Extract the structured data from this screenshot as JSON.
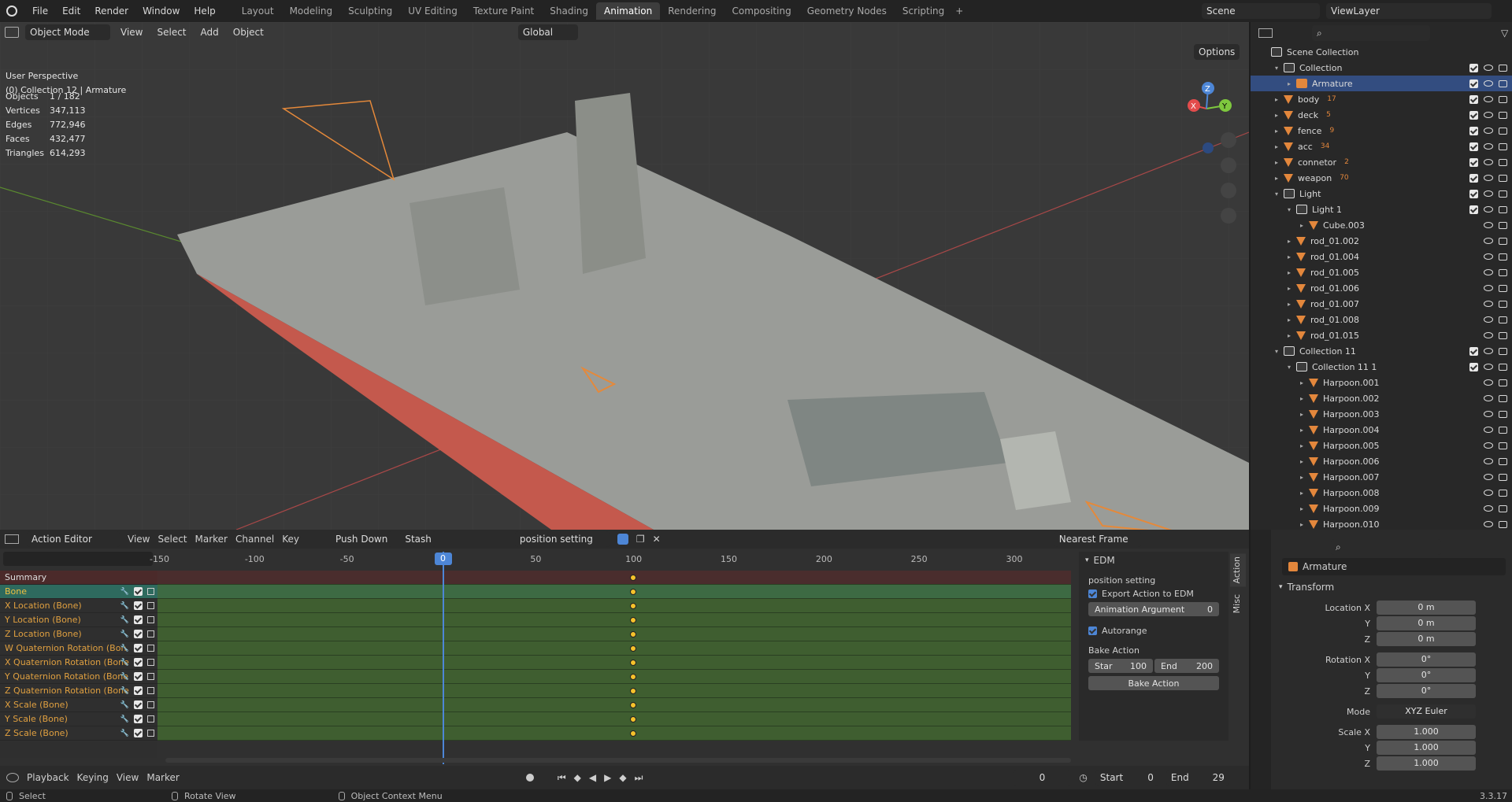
{
  "topbar": {
    "menus": [
      "File",
      "Edit",
      "Render",
      "Window",
      "Help"
    ],
    "workspaces": [
      "Layout",
      "Modeling",
      "Sculpting",
      "UV Editing",
      "Texture Paint",
      "Shading",
      "Animation",
      "Rendering",
      "Compositing",
      "Geometry Nodes",
      "Scripting"
    ],
    "active_workspace": "Animation",
    "scene": "Scene",
    "view_layer": "ViewLayer"
  },
  "viewport": {
    "mode": "Object Mode",
    "menus": [
      "View",
      "Select",
      "Add",
      "Object"
    ],
    "orientation": "Global",
    "options": "Options",
    "perspective": "User Perspective",
    "context": "(0) Collection 12 | Armature",
    "stats": [
      {
        "k": "Objects",
        "v": "1 / 182"
      },
      {
        "k": "Vertices",
        "v": "347,113"
      },
      {
        "k": "Edges",
        "v": "772,946"
      },
      {
        "k": "Faces",
        "v": "432,477"
      },
      {
        "k": "Triangles",
        "v": "614,293"
      }
    ],
    "gizmo": {
      "x": "X",
      "y": "Y",
      "z": "Z"
    }
  },
  "outliner": {
    "root": "Scene Collection",
    "rows": [
      {
        "label": "Collection",
        "indent": 1,
        "type": "coll",
        "tri": "▾",
        "vis": true
      },
      {
        "label": "Armature",
        "indent": 2,
        "type": "arm",
        "tri": "▸",
        "vis": true,
        "selected": true
      },
      {
        "label": "body",
        "indent": 1,
        "type": "mesh",
        "tri": "▸",
        "vis": true,
        "badge": "17"
      },
      {
        "label": "deck",
        "indent": 1,
        "type": "mesh",
        "tri": "▸",
        "vis": true,
        "badge": "5"
      },
      {
        "label": "fence",
        "indent": 1,
        "type": "mesh",
        "tri": "▸",
        "vis": true,
        "badge": "9"
      },
      {
        "label": "acc",
        "indent": 1,
        "type": "mesh",
        "tri": "▸",
        "vis": true,
        "badge": "34"
      },
      {
        "label": "connetor",
        "indent": 1,
        "type": "mesh",
        "tri": "▸",
        "vis": true,
        "badge": "2"
      },
      {
        "label": "weapon",
        "indent": 1,
        "type": "mesh",
        "tri": "▸",
        "vis": true,
        "badge": "70"
      },
      {
        "label": "Light",
        "indent": 1,
        "type": "coll",
        "tri": "▾",
        "vis": true
      },
      {
        "label": "Light 1",
        "indent": 2,
        "type": "coll",
        "tri": "▾",
        "vis": true
      },
      {
        "label": "Cube.003",
        "indent": 3,
        "type": "mesh",
        "tri": "▸",
        "vis": false
      },
      {
        "label": "rod_01.002",
        "indent": 2,
        "type": "mesh",
        "tri": "▸",
        "vis": false
      },
      {
        "label": "rod_01.004",
        "indent": 2,
        "type": "mesh",
        "tri": "▸",
        "vis": false
      },
      {
        "label": "rod_01.005",
        "indent": 2,
        "type": "mesh",
        "tri": "▸",
        "vis": false
      },
      {
        "label": "rod_01.006",
        "indent": 2,
        "type": "mesh",
        "tri": "▸",
        "vis": false
      },
      {
        "label": "rod_01.007",
        "indent": 2,
        "type": "mesh",
        "tri": "▸",
        "vis": false
      },
      {
        "label": "rod_01.008",
        "indent": 2,
        "type": "mesh",
        "tri": "▸",
        "vis": false
      },
      {
        "label": "rod_01.015",
        "indent": 2,
        "type": "mesh",
        "tri": "▸",
        "vis": false
      },
      {
        "label": "Collection 11",
        "indent": 1,
        "type": "coll",
        "tri": "▾",
        "vis": true
      },
      {
        "label": "Collection 11 1",
        "indent": 2,
        "type": "coll",
        "tri": "▾",
        "vis": true
      },
      {
        "label": "Harpoon.001",
        "indent": 3,
        "type": "mesh",
        "tri": "▸",
        "vis": false
      },
      {
        "label": "Harpoon.002",
        "indent": 3,
        "type": "mesh",
        "tri": "▸",
        "vis": false
      },
      {
        "label": "Harpoon.003",
        "indent": 3,
        "type": "mesh",
        "tri": "▸",
        "vis": false
      },
      {
        "label": "Harpoon.004",
        "indent": 3,
        "type": "mesh",
        "tri": "▸",
        "vis": false
      },
      {
        "label": "Harpoon.005",
        "indent": 3,
        "type": "mesh",
        "tri": "▸",
        "vis": false
      },
      {
        "label": "Harpoon.006",
        "indent": 3,
        "type": "mesh",
        "tri": "▸",
        "vis": false
      },
      {
        "label": "Harpoon.007",
        "indent": 3,
        "type": "mesh",
        "tri": "▸",
        "vis": false
      },
      {
        "label": "Harpoon.008",
        "indent": 3,
        "type": "mesh",
        "tri": "▸",
        "vis": false
      },
      {
        "label": "Harpoon.009",
        "indent": 3,
        "type": "mesh",
        "tri": "▸",
        "vis": false
      },
      {
        "label": "Harpoon.010",
        "indent": 3,
        "type": "mesh",
        "tri": "▸",
        "vis": false
      }
    ]
  },
  "action_editor": {
    "editor": "Action Editor",
    "menus": [
      "View",
      "Select",
      "Marker",
      "Channel",
      "Key"
    ],
    "push_down": "Push Down",
    "stash": "Stash",
    "action_name": "position setting",
    "snap": "Nearest Frame",
    "ruler_ticks": [
      "-150",
      "-100",
      "-50",
      "0",
      "50",
      "100",
      "150",
      "200",
      "250",
      "300"
    ],
    "current_frame": "0",
    "channels": [
      {
        "label": "Summary",
        "kind": "sum"
      },
      {
        "label": "Bone",
        "kind": "bone"
      },
      {
        "label": "X Location (Bone)",
        "kind": "ch"
      },
      {
        "label": "Y Location (Bone)",
        "kind": "ch"
      },
      {
        "label": "Z Location (Bone)",
        "kind": "ch"
      },
      {
        "label": "W Quaternion Rotation (Bon",
        "kind": "ch"
      },
      {
        "label": "X Quaternion Rotation (Bone",
        "kind": "ch"
      },
      {
        "label": "Y Quaternion Rotation (Bone",
        "kind": "ch"
      },
      {
        "label": "Z Quaternion Rotation (Bone",
        "kind": "ch"
      },
      {
        "label": "X Scale (Bone)",
        "kind": "ch"
      },
      {
        "label": "Y Scale (Bone)",
        "kind": "ch"
      },
      {
        "label": "Z Scale (Bone)",
        "kind": "ch"
      }
    ],
    "keyframe_frame": 100,
    "frame_range": [
      -150,
      300
    ]
  },
  "npanel": {
    "header": "EDM",
    "action": "position setting",
    "export_label": "Export Action to EDM",
    "anim_arg_label": "Animation Argument",
    "anim_arg_value": "0",
    "autorange": "Autorange",
    "bake_header": "Bake Action",
    "start_label": "Star",
    "start_value": "100",
    "end_label": "End",
    "end_value": "200",
    "bake_button": "Bake Action",
    "tabs": [
      "Action",
      "Misc"
    ]
  },
  "properties": {
    "object": "Armature",
    "transform": "Transform",
    "location": {
      "x": "0 m",
      "y": "0 m",
      "z": "0 m"
    },
    "rotation": {
      "x": "0°",
      "y": "0°",
      "z": "0°"
    },
    "mode_label": "Mode",
    "mode": "XYZ Euler",
    "scale": {
      "x": "1.000",
      "y": "1.000",
      "z": "1.000"
    },
    "labels": {
      "loc_x": "Location X",
      "rot_x": "Rotation X",
      "scale_x": "Scale X",
      "y": "Y",
      "z": "Z"
    }
  },
  "timeline": {
    "menus": [
      "Playback",
      "Keying",
      "View",
      "Marker"
    ],
    "frame": "0",
    "start_label": "Start",
    "start": "0",
    "end_label": "End",
    "end": "29"
  },
  "status": {
    "select": "Select",
    "rotate": "Rotate View",
    "context": "Object Context Menu",
    "version": "3.3.17"
  }
}
